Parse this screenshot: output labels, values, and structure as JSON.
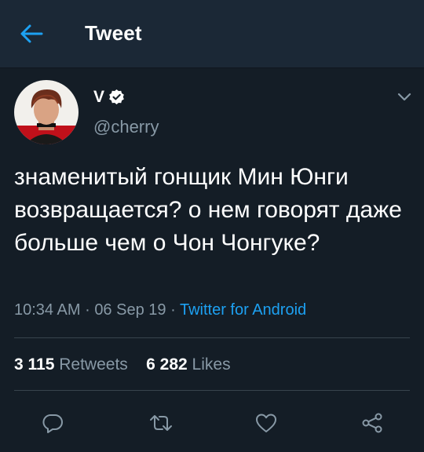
{
  "header": {
    "back_icon": "arrow-left-icon",
    "title": "Tweet"
  },
  "tweet": {
    "author_name": "V",
    "verified_icon": "verified-badge-icon",
    "handle": "@cherry",
    "menu_icon": "chevron-down-icon",
    "text": "знаменитый гонщик Мин Юнги возвращается? о нем говорят даже больше чем о Чон Чонгуке?",
    "time": "10:34 AM",
    "date": "06 Sep 19",
    "separator": "·",
    "source": "Twitter for Android"
  },
  "stats": {
    "retweets_count": "3 115",
    "retweets_label": "Retweets",
    "likes_count": "6 282",
    "likes_label": "Likes"
  },
  "actions": {
    "reply_icon": "reply-icon",
    "retweet_icon": "retweet-icon",
    "like_icon": "heart-icon",
    "share_icon": "share-icon"
  },
  "colors": {
    "background": "#141d26",
    "header_background": "#1b2836",
    "accent": "#1da1f2",
    "secondary_text": "#8899a6",
    "divider": "#38444d"
  }
}
